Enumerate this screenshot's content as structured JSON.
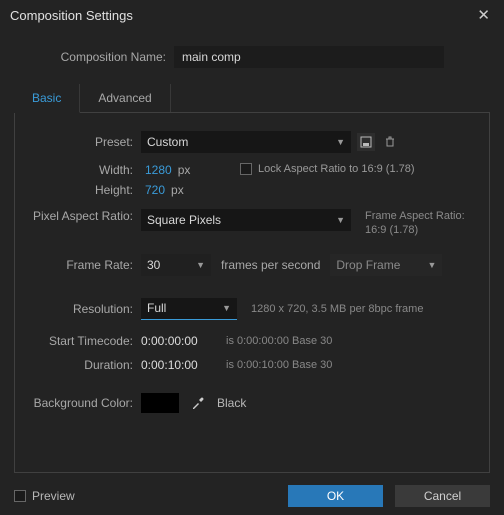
{
  "title": "Composition Settings",
  "name_label": "Composition Name:",
  "name_value": "main comp",
  "tabs": {
    "basic": "Basic",
    "advanced": "Advanced"
  },
  "preset": {
    "label": "Preset:",
    "value": "Custom"
  },
  "width": {
    "label": "Width:",
    "value": "1280",
    "unit": "px"
  },
  "height": {
    "label": "Height:",
    "value": "720",
    "unit": "px"
  },
  "lock_ratio": "Lock Aspect Ratio to 16:9 (1.78)",
  "par": {
    "label": "Pixel Aspect Ratio:",
    "value": "Square Pixels"
  },
  "far": {
    "label": "Frame Aspect Ratio:",
    "value": "16:9 (1.78)"
  },
  "fps": {
    "label": "Frame Rate:",
    "value": "30",
    "suffix": "frames per second",
    "drop": "Drop Frame"
  },
  "resolution": {
    "label": "Resolution:",
    "value": "Full",
    "hint": "1280 x 720, 3.5 MB per 8bpc frame"
  },
  "start_tc": {
    "label": "Start Timecode:",
    "value": "0:00:00:00",
    "hint": "is 0:00:00:00  Base 30"
  },
  "duration": {
    "label": "Duration:",
    "value": "0:00:10:00",
    "hint": "is 0:00:10:00  Base 30"
  },
  "bg": {
    "label": "Background Color:",
    "name": "Black"
  },
  "preview": "Preview",
  "ok": "OK",
  "cancel": "Cancel"
}
